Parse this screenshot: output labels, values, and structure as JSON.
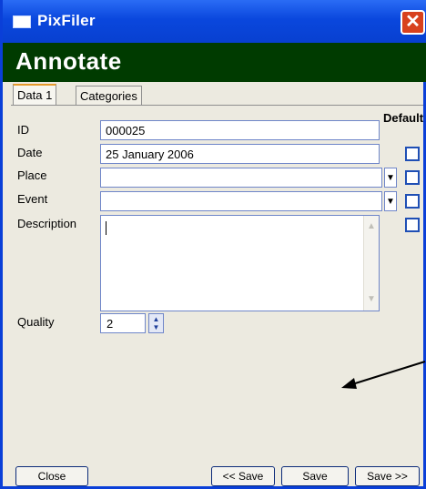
{
  "window": {
    "title": "PixFiler",
    "close_glyph": "✕"
  },
  "banner": {
    "title": "Annotate"
  },
  "tabs": [
    {
      "label": "Data 1",
      "active": true
    },
    {
      "label": "Categories",
      "active": false
    }
  ],
  "default_label": "Default",
  "fields": {
    "id": {
      "label": "ID",
      "value": "000025"
    },
    "date": {
      "label": "Date",
      "value": "25 January 2006"
    },
    "place": {
      "label": "Place",
      "value": ""
    },
    "event": {
      "label": "Event",
      "value": ""
    },
    "description": {
      "label": "Description",
      "value": ""
    },
    "quality": {
      "label": "Quality",
      "value": "2"
    }
  },
  "buttons": {
    "close": "Close",
    "prev_save": "<< Save",
    "save": "Save",
    "next_save": "Save >>"
  },
  "colors": {
    "titlebar": "#0a47dd",
    "banner": "#003b00",
    "checkbox_border": "#1f4fb5"
  }
}
